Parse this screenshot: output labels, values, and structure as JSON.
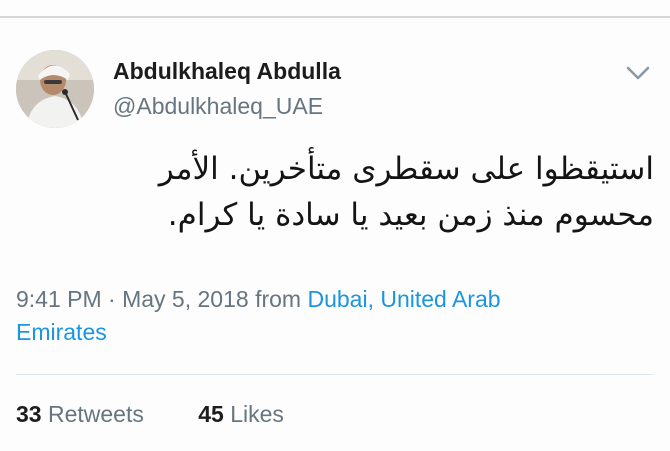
{
  "tweet": {
    "author": {
      "name": "Abdulkhaleq Abdulla",
      "handle": "@Abdulkhaleq_UAE"
    },
    "text_lines": [
      "استيقظوا على سقطرى متأخرين. الأمر",
      "محسوم منذ زمن بعيد يا سادة يا كرام."
    ],
    "timestamp": "9:41 PM · May 5, 2018",
    "from_label": "from",
    "location_line1": "Dubai, United Arab",
    "location_line2": "Emirates",
    "retweets": {
      "count": "33",
      "label": "Retweets"
    },
    "likes": {
      "count": "45",
      "label": "Likes"
    }
  },
  "icons": {
    "menu": "chevron-down-icon"
  },
  "colors": {
    "link": "#1b95e0",
    "secondary_text": "#66757f",
    "primary_text": "#1c1c1c"
  }
}
